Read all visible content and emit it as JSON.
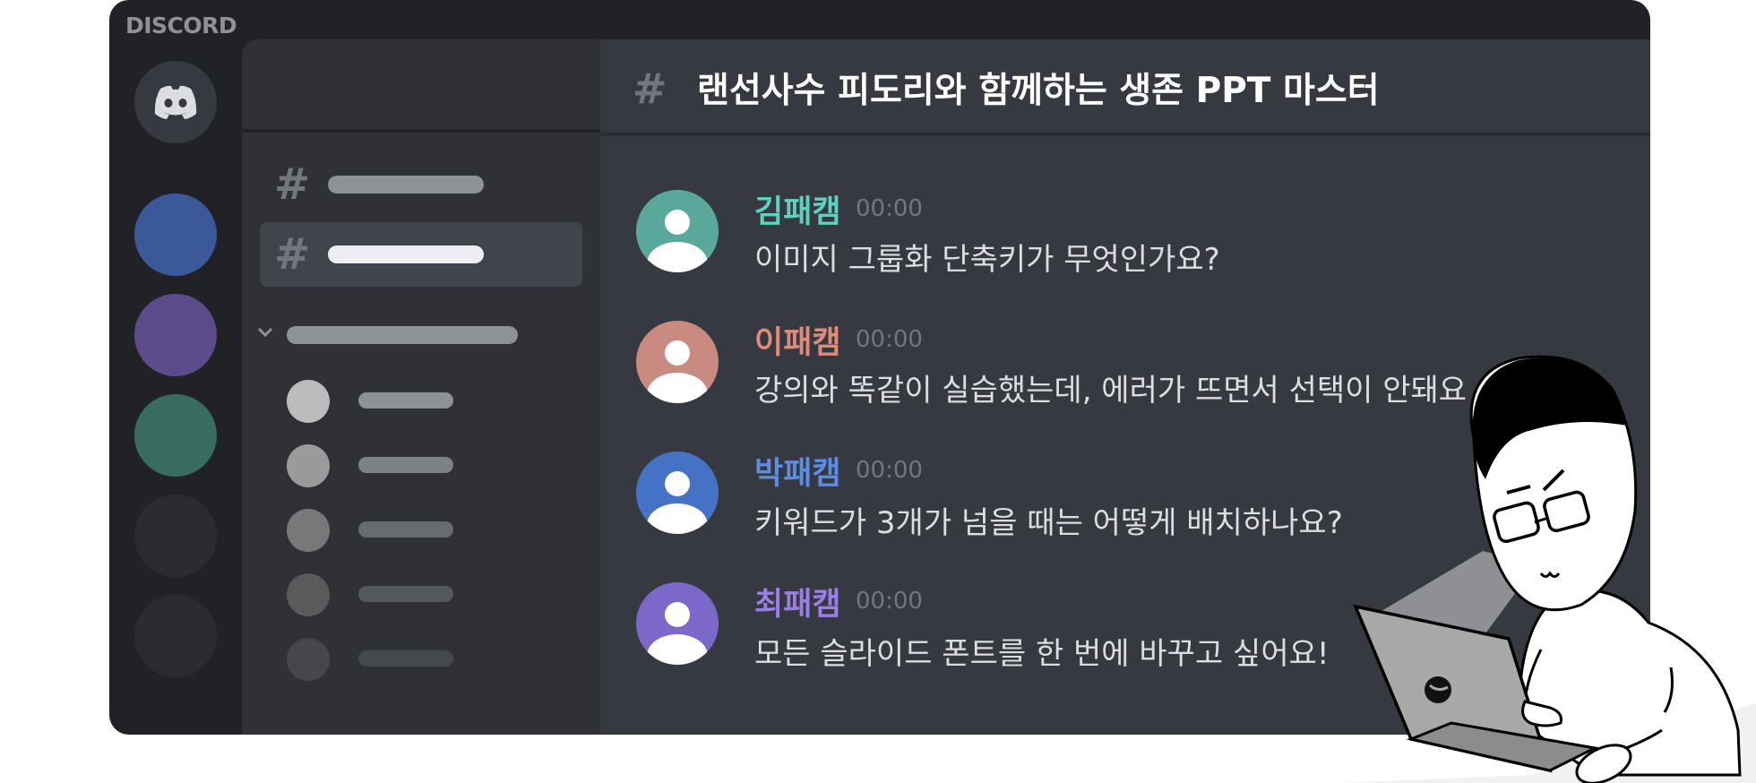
{
  "app": {
    "name": "DISCORD"
  },
  "channel": {
    "hash": "#",
    "title": "랜선사수 피도리와 함께하는 생존 PPT 마스터"
  },
  "colors": {
    "rail": "#202225",
    "panel": "#2f3136",
    "main": "#36393f",
    "servers": [
      "#3b5998",
      "#5b4b8a",
      "#3a6b5f",
      "#2f3136",
      "#2f3136"
    ]
  },
  "sidebar": {
    "channel_hash": "#"
  },
  "messages": [
    {
      "user": "김패캠",
      "time": "00:00",
      "text": "이미지 그룹화 단축키가 무엇인가요?",
      "color": "#5fd1c0",
      "avatar_color": "#5aa89b"
    },
    {
      "user": "이패캠",
      "time": "00:00",
      "text": "강의와 똑같이 실습했는데, 에러가 뜨면서 선택이 안돼요",
      "color": "#e08a7a",
      "avatar_color": "#c98a82"
    },
    {
      "user": "박패캠",
      "time": "00:00",
      "text": "키워드가 3개가 넘을 때는 어떻게 배치하나요?",
      "color": "#5b8de6",
      "avatar_color": "#4472c4"
    },
    {
      "user": "최패캠",
      "time": "00:00",
      "text": "모든 슬라이드 폰트를 한 번에 바꾸고 싶어요!",
      "color": "#9b7fe6",
      "avatar_color": "#7b68c8"
    }
  ],
  "icons": {
    "discord_logo": "discord-logo-icon",
    "user": "user-icon",
    "collapse": "chevron-down-icon",
    "laptop": "laptop-icon"
  }
}
